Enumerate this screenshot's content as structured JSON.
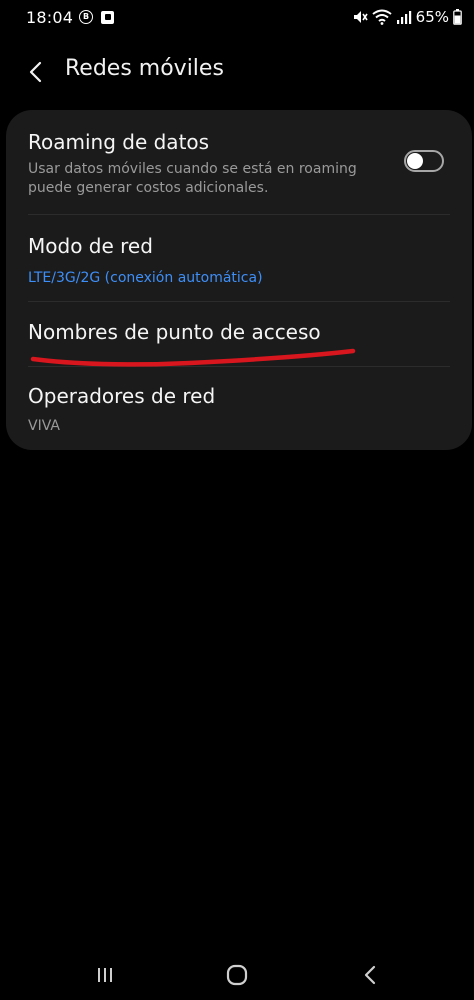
{
  "status_bar": {
    "time": "18:04",
    "battery": "65%"
  },
  "header": {
    "title": "Redes móviles"
  },
  "settings": {
    "roaming": {
      "title": "Roaming de datos",
      "subtitle": "Usar datos móviles cuando se está en roaming puede generar costos adicionales.",
      "enabled": false
    },
    "network_mode": {
      "title": "Modo de red",
      "value": "LTE/3G/2G (conexión automática)"
    },
    "apn": {
      "title": "Nombres de punto de acceso"
    },
    "operators": {
      "title": "Operadores de red",
      "value": "VIVA"
    }
  },
  "annotation": {
    "underline_color": "#d8161d"
  },
  "colors": {
    "background": "#000000",
    "card": "#1b1b1b",
    "accent_blue": "#3e8ef7",
    "secondary_text": "#9a9a9a"
  },
  "nav_bar": {
    "icons": [
      "recents-icon",
      "home-icon",
      "back-icon"
    ]
  }
}
